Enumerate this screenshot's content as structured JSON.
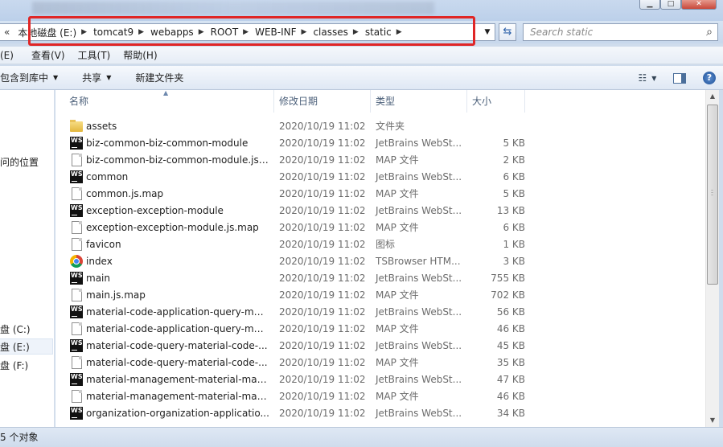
{
  "window": {
    "controls": {
      "minimize": "▁",
      "maximize": "□",
      "close": "✕"
    }
  },
  "address": {
    "lead": "«",
    "crumbs": [
      "本地磁盘 (E:)",
      "tomcat9",
      "webapps",
      "ROOT",
      "WEB-INF",
      "classes",
      "static"
    ],
    "highlight_color": "#e02626"
  },
  "search": {
    "placeholder": "Search static"
  },
  "menu": [
    "(E)",
    "查看(V)",
    "工具(T)",
    "帮助(H)"
  ],
  "commands": {
    "include_library": "包含到库中",
    "share": "共享",
    "new_folder": "新建文件夹"
  },
  "nav": {
    "items": [
      "问的位置",
      "盘 (C:)",
      "盘 (E:)",
      "盘 (F:)"
    ],
    "selected": "盘 (E:)"
  },
  "columns": {
    "name": "名称",
    "date": "修改日期",
    "type": "类型",
    "size": "大小"
  },
  "files": [
    {
      "icon": "folder",
      "name": "assets",
      "date": "2020/10/19 11:02",
      "type": "文件夹",
      "size": ""
    },
    {
      "icon": "ws",
      "name": "biz-common-biz-common-module",
      "date": "2020/10/19 11:02",
      "type": "JetBrains WebSt...",
      "size": "5 KB"
    },
    {
      "icon": "doc",
      "name": "biz-common-biz-common-module.js....",
      "date": "2020/10/19 11:02",
      "type": "MAP 文件",
      "size": "2 KB"
    },
    {
      "icon": "ws",
      "name": "common",
      "date": "2020/10/19 11:02",
      "type": "JetBrains WebSt...",
      "size": "6 KB"
    },
    {
      "icon": "doc",
      "name": "common.js.map",
      "date": "2020/10/19 11:02",
      "type": "MAP 文件",
      "size": "5 KB"
    },
    {
      "icon": "ws",
      "name": "exception-exception-module",
      "date": "2020/10/19 11:02",
      "type": "JetBrains WebSt...",
      "size": "13 KB"
    },
    {
      "icon": "doc",
      "name": "exception-exception-module.js.map",
      "date": "2020/10/19 11:02",
      "type": "MAP 文件",
      "size": "6 KB"
    },
    {
      "icon": "doc",
      "name": "favicon",
      "date": "2020/10/19 11:02",
      "type": "图标",
      "size": "1 KB"
    },
    {
      "icon": "chrome",
      "name": "index",
      "date": "2020/10/19 11:02",
      "type": "TSBrowser HTM...",
      "size": "3 KB"
    },
    {
      "icon": "ws",
      "name": "main",
      "date": "2020/10/19 11:02",
      "type": "JetBrains WebSt...",
      "size": "755 KB"
    },
    {
      "icon": "doc",
      "name": "main.js.map",
      "date": "2020/10/19 11:02",
      "type": "MAP 文件",
      "size": "702 KB"
    },
    {
      "icon": "ws",
      "name": "material-code-application-query-mat...",
      "date": "2020/10/19 11:02",
      "type": "JetBrains WebSt...",
      "size": "56 KB"
    },
    {
      "icon": "doc",
      "name": "material-code-application-query-mat...",
      "date": "2020/10/19 11:02",
      "type": "MAP 文件",
      "size": "46 KB"
    },
    {
      "icon": "ws",
      "name": "material-code-query-material-code-...",
      "date": "2020/10/19 11:02",
      "type": "JetBrains WebSt...",
      "size": "45 KB"
    },
    {
      "icon": "doc",
      "name": "material-code-query-material-code-...",
      "date": "2020/10/19 11:02",
      "type": "MAP 文件",
      "size": "35 KB"
    },
    {
      "icon": "ws",
      "name": "material-management-material-mana...",
      "date": "2020/10/19 11:02",
      "type": "JetBrains WebSt...",
      "size": "47 KB"
    },
    {
      "icon": "doc",
      "name": "material-management-material-mana...",
      "date": "2020/10/19 11:02",
      "type": "MAP 文件",
      "size": "46 KB"
    },
    {
      "icon": "ws",
      "name": "organization-organization-applicatio...",
      "date": "2020/10/19 11:02",
      "type": "JetBrains WebSt...",
      "size": "34 KB"
    }
  ],
  "status": {
    "count_text": "5 个对象"
  }
}
